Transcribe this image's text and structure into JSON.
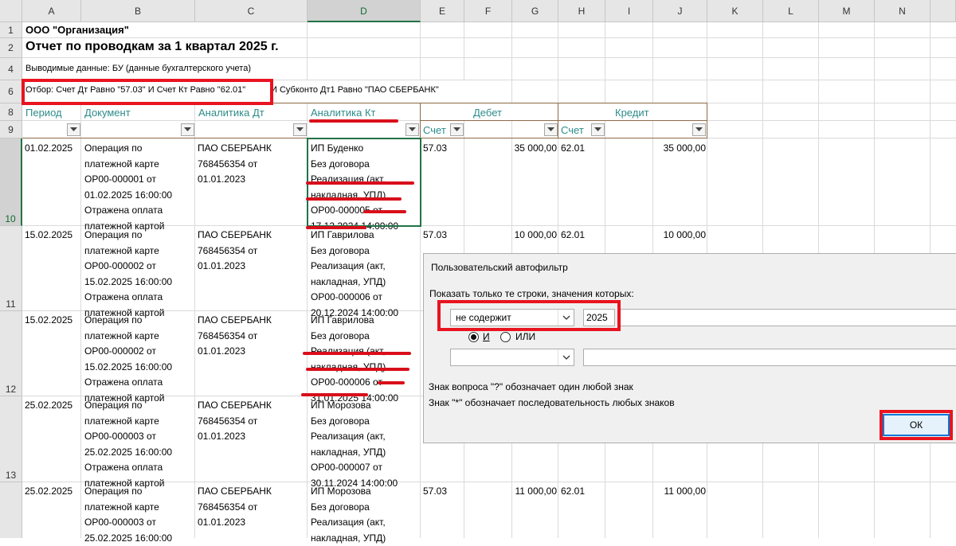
{
  "column_headers": [
    "A",
    "B",
    "C",
    "D",
    "E",
    "F",
    "G",
    "H",
    "I",
    "J",
    "K",
    "L",
    "M",
    "N"
  ],
  "row_headers": [
    "1",
    "2",
    "4",
    "6",
    "8",
    "9",
    "10",
    "11",
    "12",
    "13"
  ],
  "sheet": {
    "org": "ООО \"Организация\"",
    "title": "Отчет по проводкам за 1 квартал 2025 г.",
    "data_shown": "Выводимые данные: БУ (данные бухгалтерского учета)",
    "filter_part1": "Отбор: Счет Дт Равно \"57.03\" И Счет Кт Равно \"62.01\"",
    "filter_part2": "И Субконто Дт1 Равно \"ПАО СБЕРБАНК\""
  },
  "headers": {
    "period": "Период",
    "document": "Документ",
    "analytics_dt": "Аналитика Дт",
    "analytics_kt": "Аналитика Кт",
    "debit": "Дебет",
    "credit": "Кредит",
    "account_dt": "Счет",
    "account_kt": "Счет"
  },
  "rows": [
    {
      "period": "01.02.2025",
      "document": [
        "Операция по",
        "платежной карте",
        "ОР00-000001 от",
        "01.02.2025 16:00:00",
        "Отражена оплата",
        "платежной картой"
      ],
      "analytics_dt": [
        "ПАО СБЕРБАНК",
        "768456354 от",
        "01.01.2023"
      ],
      "analytics_kt": [
        "ИП Буденко",
        "Без договора",
        "Реализация (акт,",
        "накладная, УПД)",
        "ОР00-000005 от",
        "17.12.2024 14:00:00"
      ],
      "acc_dt": "57.03",
      "sum_dt": "35 000,00",
      "acc_kt": "62.01",
      "sum_kt": "35 000,00"
    },
    {
      "period": "15.02.2025",
      "document": [
        "Операция по",
        "платежной карте",
        "ОР00-000002 от",
        "15.02.2025 16:00:00",
        "Отражена оплата",
        "платежной картой"
      ],
      "analytics_dt": [
        "ПАО СБЕРБАНК",
        "768456354 от",
        "01.01.2023"
      ],
      "analytics_kt": [
        "ИП Гаврилова",
        "Без договора",
        "Реализация (акт,",
        "накладная, УПД)",
        "ОР00-000006 от",
        "20.12.2024 14:00:00"
      ],
      "acc_dt": "57.03",
      "sum_dt": "10 000,00",
      "acc_kt": "62.01",
      "sum_kt": "10 000,00"
    },
    {
      "period": "15.02.2025",
      "document": [
        "Операция по",
        "платежной карте",
        "ОР00-000002 от",
        "15.02.2025 16:00:00",
        "Отражена оплата",
        "платежной картой"
      ],
      "analytics_dt": [
        "ПАО СБЕРБАНК",
        "768456354 от",
        "01.01.2023"
      ],
      "analytics_kt": [
        "ИП Гаврилова",
        "Без договора",
        "Реализация (акт,",
        "накладная, УПД)",
        "ОР00-000006 от",
        "31.01.2025 14:00:00"
      ],
      "acc_dt": "",
      "sum_dt": "",
      "acc_kt": "",
      "sum_kt": ""
    },
    {
      "period": "25.02.2025",
      "document": [
        "Операция по",
        "платежной карте",
        "ОР00-000003 от",
        "25.02.2025 16:00:00",
        "Отражена оплата",
        "платежной картой"
      ],
      "analytics_dt": [
        "ПАО СБЕРБАНК",
        "768456354 от",
        "01.01.2023"
      ],
      "analytics_kt": [
        "ИП Морозова",
        "Без договора",
        "Реализация (акт,",
        "накладная, УПД)",
        "ОР00-000007 от",
        "30.11.2024 14:00:00"
      ],
      "acc_dt": "",
      "sum_dt": "",
      "acc_kt": "",
      "sum_kt": ""
    },
    {
      "period": "25.02.2025",
      "document": [
        "Операция по",
        "платежной карте",
        "ОР00-000003 от",
        "25.02.2025 16:00:00"
      ],
      "analytics_dt": [
        "ПАО СБЕРБАНК",
        "768456354 от",
        "01.01.2023"
      ],
      "analytics_kt": [
        "ИП Морозова",
        "Без договора",
        "Реализация (акт,",
        "накладная, УПД)"
      ],
      "acc_dt": "57.03",
      "sum_dt": "11 000,00",
      "acc_kt": "62.01",
      "sum_kt": "11 000,00"
    }
  ],
  "dialog": {
    "title": "Пользовательский автофильтр",
    "prompt": "Показать только те строки, значения которых:",
    "condition1_operator": "не содержит",
    "condition1_value": "2025",
    "and_label": "И",
    "or_label": "ИЛИ",
    "condition2_operator": "",
    "condition2_value": "",
    "hint1": "Знак вопроса \"?\" обозначает один любой знак",
    "hint2": "Знак \"*\" обозначает последовательность любых знаков",
    "ok_label": "ОК"
  },
  "colors": {
    "accent_red": "#e8141f",
    "header_teal": "#2e8b8b",
    "excel_green": "#217346",
    "border_brown": "#8c6b47"
  }
}
